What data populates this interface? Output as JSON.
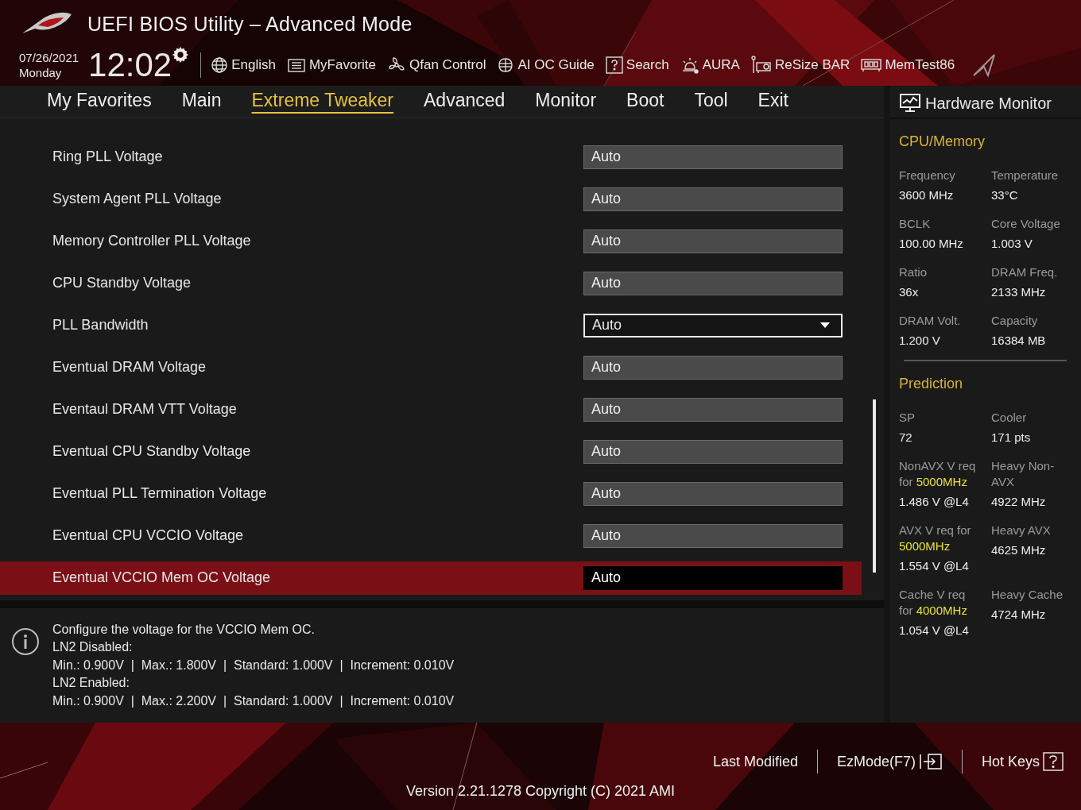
{
  "window": {
    "title": "UEFI BIOS Utility – Advanced Mode"
  },
  "clock": {
    "date": "07/26/2021",
    "day": "Monday",
    "time": "12:02"
  },
  "toolbar": [
    {
      "label": "English"
    },
    {
      "label": "MyFavorite"
    },
    {
      "label": "Qfan Control"
    },
    {
      "label": "AI OC Guide"
    },
    {
      "label": "Search"
    },
    {
      "label": "AURA"
    },
    {
      "label": "ReSize BAR"
    },
    {
      "label": "MemTest86"
    }
  ],
  "tabs": [
    {
      "label": "My Favorites",
      "selected": false
    },
    {
      "label": "Main",
      "selected": false
    },
    {
      "label": "Extreme Tweaker",
      "selected": true
    },
    {
      "label": "Advanced",
      "selected": false
    },
    {
      "label": "Monitor",
      "selected": false
    },
    {
      "label": "Boot",
      "selected": false
    },
    {
      "label": "Tool",
      "selected": false
    },
    {
      "label": "Exit",
      "selected": false
    }
  ],
  "settings": [
    {
      "label": "Ring PLL Voltage",
      "value": "Auto",
      "kind": "text",
      "selected": false
    },
    {
      "label": "System Agent PLL Voltage",
      "value": "Auto",
      "kind": "text",
      "selected": false
    },
    {
      "label": "Memory Controller PLL Voltage",
      "value": "Auto",
      "kind": "text",
      "selected": false
    },
    {
      "label": "CPU Standby Voltage",
      "value": "Auto",
      "kind": "text",
      "selected": false
    },
    {
      "label": "PLL Bandwidth",
      "value": "Auto",
      "kind": "dropdown",
      "selected": false
    },
    {
      "label": "Eventual DRAM Voltage",
      "value": "Auto",
      "kind": "text",
      "selected": false
    },
    {
      "label": "Eventaul DRAM VTT Voltage",
      "value": "Auto",
      "kind": "text",
      "selected": false
    },
    {
      "label": "Eventual CPU Standby Voltage",
      "value": "Auto",
      "kind": "text",
      "selected": false
    },
    {
      "label": "Eventual PLL Termination Voltage",
      "value": "Auto",
      "kind": "text",
      "selected": false
    },
    {
      "label": "Eventual CPU VCCIO Voltage",
      "value": "Auto",
      "kind": "text",
      "selected": false
    },
    {
      "label": "Eventual VCCIO Mem OC Voltage",
      "value": "Auto",
      "kind": "text",
      "selected": true
    }
  ],
  "info": {
    "lines": [
      "Configure the voltage for the VCCIO Mem OC.",
      "LN2 Disabled:",
      "Min.: 0.900V  |  Max.: 1.800V  |  Standard: 1.000V  |  Increment: 0.010V",
      "LN2 Enabled:",
      "Min.: 0.900V  |  Max.: 2.200V  |  Standard: 1.000V  |  Increment: 0.010V"
    ]
  },
  "hardware_monitor": {
    "title": "Hardware Monitor",
    "sections": [
      {
        "title": "CPU/Memory",
        "items": [
          {
            "label": "Frequency",
            "value": "3600 MHz"
          },
          {
            "label": "Temperature",
            "value": "33°C"
          },
          {
            "label": "BCLK",
            "value": "100.00 MHz"
          },
          {
            "label": "Core Voltage",
            "value": "1.003 V"
          },
          {
            "label": "Ratio",
            "value": "36x"
          },
          {
            "label": "DRAM Freq.",
            "value": "2133 MHz"
          },
          {
            "label": "DRAM Volt.",
            "value": "1.200 V"
          },
          {
            "label": "Capacity",
            "value": "16384 MB"
          }
        ]
      },
      {
        "title": "Prediction",
        "items": [
          {
            "label": "SP",
            "value": "72"
          },
          {
            "label": "Cooler",
            "value": "171 pts"
          },
          {
            "label": "NonAVX V req for **5000MHz**",
            "value": "1.486 V @L4"
          },
          {
            "label": "Heavy Non-AVX",
            "value": "4922 MHz"
          },
          {
            "label": "AVX V req for **5000MHz**",
            "value": "1.554 V @L4"
          },
          {
            "label": "Heavy AVX",
            "value": "4625 MHz"
          },
          {
            "label": "Cache V req for **4000MHz**",
            "value": "1.054 V @L4"
          },
          {
            "label": "Heavy Cache",
            "value": "4724 MHz"
          }
        ]
      }
    ]
  },
  "footer": {
    "last_modified": "Last Modified",
    "ez_mode": "EzMode(F7)",
    "hot_keys": "Hot Keys",
    "version": "Version 2.21.1278 Copyright (C) 2021 AMI"
  }
}
